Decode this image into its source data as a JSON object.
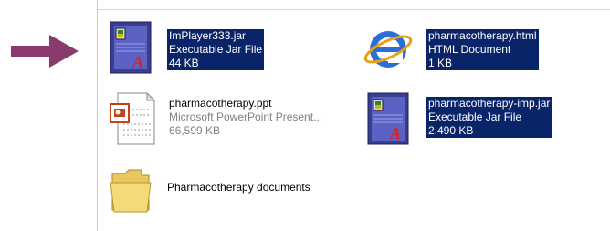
{
  "files": [
    {
      "name": "ImPlayer333.jar",
      "type": "Executable Jar File",
      "size": "44 KB",
      "icon": "jar-file-icon",
      "selected": true
    },
    {
      "name": "pharmacotherapy.html",
      "type": "HTML Document",
      "size": "1 KB",
      "icon": "internet-explorer-icon",
      "selected": true
    },
    {
      "name": "pharmacotherapy.ppt",
      "type": "Microsoft PowerPoint Present...",
      "size": "66,599 KB",
      "icon": "powerpoint-file-icon",
      "selected": false
    },
    {
      "name": "pharmacotherapy-imp.jar",
      "type": "Executable Jar File",
      "size": "2,490 KB",
      "icon": "jar-file-icon",
      "selected": true
    },
    {
      "name": "Pharmacotherapy documents",
      "icon": "folder-icon",
      "selected": false
    }
  ],
  "colors": {
    "selection": "#0a246a",
    "arrow": "#8b3a6e"
  }
}
